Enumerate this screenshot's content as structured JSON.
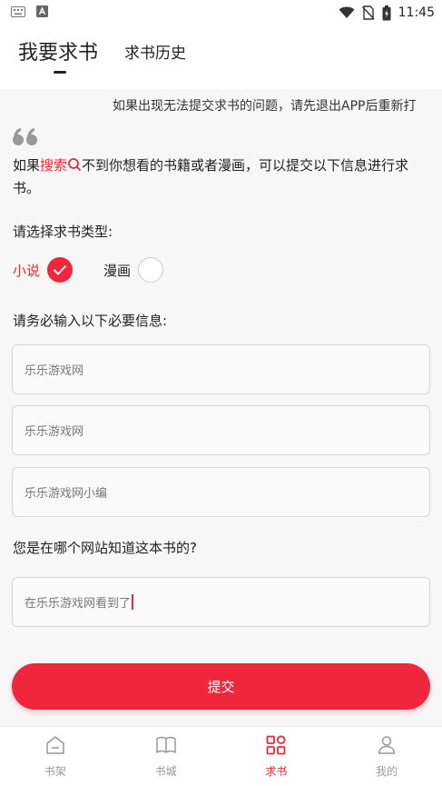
{
  "status_bar": {
    "time": "11:45",
    "icons": [
      "keyboard-icon",
      "a-badge-icon",
      "wifi-icon",
      "no-sim-icon",
      "battery-icon"
    ]
  },
  "header": {
    "tab_main": "我要求书",
    "tab_history": "求书历史"
  },
  "notice": "如果出现无法提交求书的问题，请先退出APP后重新打",
  "intro": {
    "prefix": "如果",
    "highlight": "搜索",
    "suffix": "不到你想看的书籍或者漫画，可以提交以下信息进行求书。"
  },
  "type_section": {
    "label": "请选择求书类型:",
    "options": [
      {
        "label": "小说",
        "selected": true
      },
      {
        "label": "漫画",
        "selected": false
      }
    ]
  },
  "info_section": {
    "label": "请务必输入以下必要信息:",
    "fields": [
      "乐乐游戏网",
      "乐乐游戏网",
      "乐乐游戏网小编"
    ]
  },
  "site_section": {
    "label": "您是在哪个网站知道这本书的?",
    "value": "在乐乐游戏网看到了"
  },
  "submit_label": "提交",
  "bottom_nav": [
    {
      "label": "书架",
      "icon": "bookshelf-icon",
      "active": false
    },
    {
      "label": "书城",
      "icon": "book-open-icon",
      "active": false
    },
    {
      "label": "求书",
      "icon": "grid-icon",
      "active": true
    },
    {
      "label": "我的",
      "icon": "user-icon",
      "active": false
    }
  ],
  "colors": {
    "accent": "#f0263c",
    "background": "#f7f7f7",
    "nav_inactive": "#999999"
  }
}
